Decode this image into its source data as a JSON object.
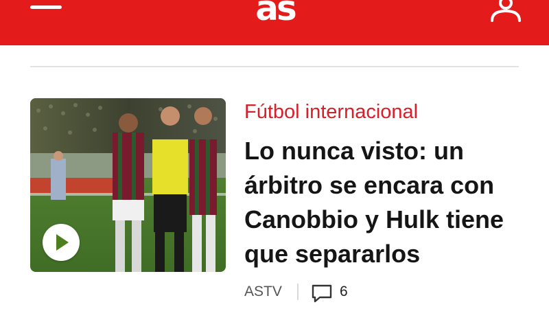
{
  "colors": {
    "brand": "#e41b1b",
    "section": "#d5202a",
    "headline": "#151515",
    "meta": "#555555",
    "play": "#4d7f1e"
  },
  "header": {
    "logo_text": "as",
    "menu_icon": "hamburger-menu-icon",
    "user_icon": "user-account-icon"
  },
  "article": {
    "section": "Fútbol internacional",
    "headline": "Lo nunca visto: un árbitro se encara con Canobbio y Hulk tiene que separarlos",
    "thumbnail": {
      "type": "video",
      "play_icon": "play-icon"
    },
    "source": "ASTV",
    "comment_icon": "comment-bubble-icon",
    "comment_count": "6"
  }
}
